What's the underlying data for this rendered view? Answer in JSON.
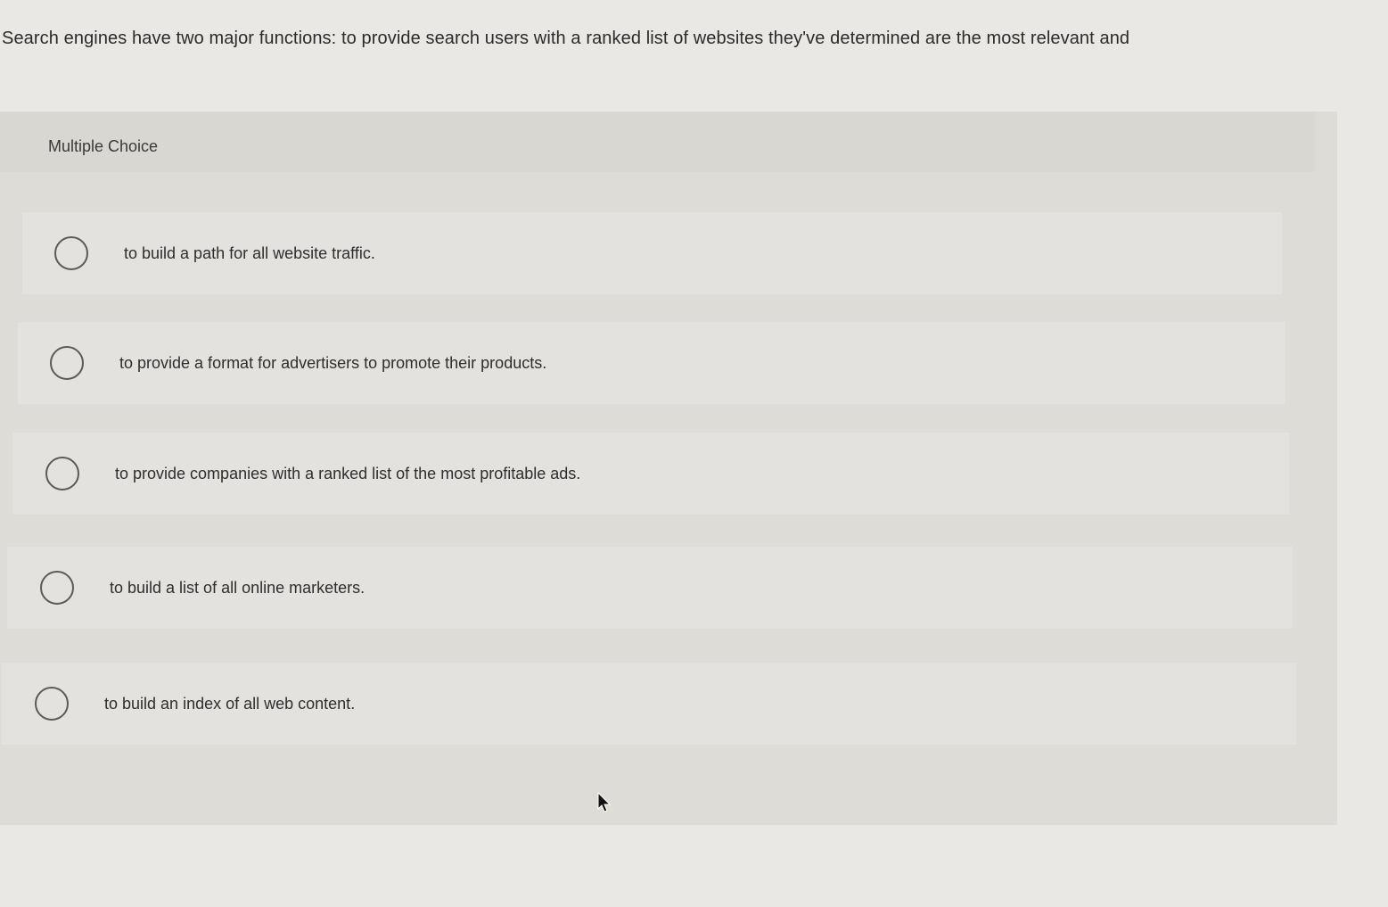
{
  "question": {
    "text": "Search engines have two major functions: to provide search users with a ranked list of websites they've determined are the most relevant and"
  },
  "panel": {
    "label": "Multiple Choice"
  },
  "options": [
    {
      "label": "to build a path for all website traffic.",
      "selected": false
    },
    {
      "label": "to provide a format for advertisers to promote their products.",
      "selected": false
    },
    {
      "label": "to provide companies with a ranked list of the most profitable ads.",
      "selected": false
    },
    {
      "label": "to build a list of all online marketers.",
      "selected": false
    },
    {
      "label": "to build an index of all web content.",
      "selected": false
    }
  ],
  "icons": {
    "radio": "radio-button-icon",
    "cursor": "mouse-pointer-icon"
  }
}
